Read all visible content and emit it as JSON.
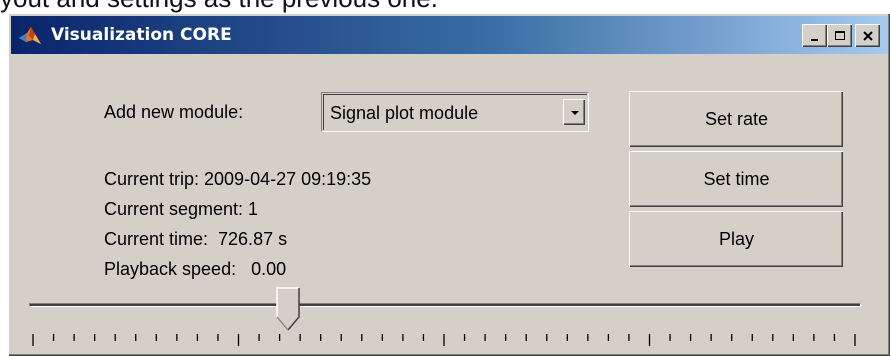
{
  "background_caption": "yout and settings as the previous one.",
  "window": {
    "title": "Visualization CORE",
    "icon": "matlab-logo-icon",
    "controls": [
      "minimize-icon",
      "maximize-icon",
      "close-icon"
    ]
  },
  "module": {
    "label": "Add new module:",
    "selected": "Signal plot module"
  },
  "status": {
    "trip": "Current trip: 2009-04-27 09:19:35",
    "segment": "Current segment: 1",
    "time": "Current time:  726.87 s",
    "speed": "Playback speed:   0.00"
  },
  "buttons": {
    "set_rate": "Set rate",
    "set_time": "Set time",
    "play": "Play"
  },
  "slider": {
    "position_fraction": 0.31,
    "tick_count": 41
  },
  "colors": {
    "title_gradient_start": "#0a246a",
    "title_gradient_end": "#a6caf0",
    "face": "#d4d0c8"
  }
}
